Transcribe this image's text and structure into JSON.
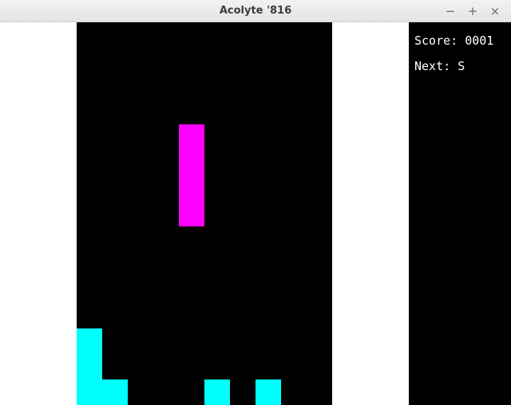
{
  "window": {
    "title": "Acolyte '816",
    "controls": {
      "minimize_icon": "−",
      "maximize_icon": "+",
      "close_icon": "×"
    }
  },
  "hud": {
    "score_label": "Score:",
    "score_value": "0001",
    "next_label": "Next:",
    "next_value": "S"
  },
  "board": {
    "columns": 10,
    "rows": 15,
    "colors": {
      "background": "#000000",
      "active_piece": "#ff00ff",
      "settled_blocks": "#00ffff"
    },
    "active_piece": {
      "type": "I",
      "cells": [
        [
          4,
          4
        ],
        [
          4,
          5
        ],
        [
          4,
          6
        ],
        [
          4,
          7
        ]
      ]
    },
    "settled_cells": [
      [
        0,
        12
      ],
      [
        0,
        13
      ],
      [
        0,
        14
      ],
      [
        1,
        14
      ],
      [
        5,
        14
      ],
      [
        7,
        14
      ]
    ]
  }
}
